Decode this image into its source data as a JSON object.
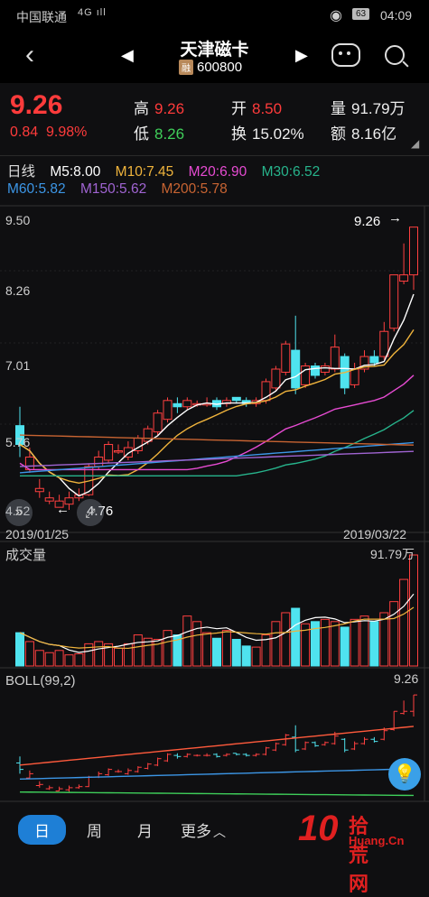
{
  "status": {
    "carrier": "中国联通",
    "signal": "4G ıll",
    "battery": "63",
    "time": "04:09"
  },
  "header": {
    "title": "天津磁卡",
    "badge": "融",
    "code": "600800"
  },
  "quote": {
    "price": "9.26",
    "change": "0.84",
    "change_pct": "9.98%",
    "high_label": "高",
    "high": "9.26",
    "low_label": "低",
    "low": "8.26",
    "open_label": "开",
    "open": "8.50",
    "turnover_label": "换",
    "turnover": "15.02%",
    "volume_label": "量",
    "volume": "91.79万",
    "amount_label": "额",
    "amount": "8.16亿"
  },
  "ma": {
    "period": "日线",
    "m5": "M5:8.00",
    "m10": "M10:7.45",
    "m20": "M20:6.90",
    "m30": "M30:6.52",
    "m60": "M60:5.82",
    "m150": "M150:5.62",
    "m200": "M200:5.78",
    "colors": {
      "m5": "#ffffff",
      "m10": "#f0b43c",
      "m20": "#e64bd2",
      "m30": "#27b48c",
      "m60": "#3c96e6",
      "m150": "#a064d2",
      "m200": "#c86432"
    }
  },
  "kline": {
    "y_top": "9.50",
    "y_mid1": "8.26",
    "y_mid2": "7.01",
    "y_low": "5.76",
    "y_min": "4.52",
    "marker_high": "9.26",
    "marker_low": "4.76",
    "date_start": "2019/01/25",
    "date_end": "2019/03/22",
    "candles": [
      [
        6.1,
        5.8,
        5.6,
        6.4
      ],
      [
        5.4,
        5.6,
        5.35,
        5.75
      ],
      [
        5.05,
        5.1,
        4.95,
        5.25
      ],
      [
        4.9,
        4.95,
        4.85,
        5.05
      ],
      [
        4.8,
        4.9,
        4.8,
        5.0
      ],
      [
        4.85,
        4.95,
        4.76,
        5.05
      ],
      [
        4.95,
        5.0,
        4.9,
        5.1
      ],
      [
        5.0,
        5.45,
        4.98,
        5.5
      ],
      [
        5.45,
        5.6,
        5.4,
        5.7
      ],
      [
        5.55,
        5.8,
        5.5,
        5.85
      ],
      [
        5.7,
        5.7,
        5.65,
        5.8
      ],
      [
        5.6,
        5.75,
        5.55,
        5.85
      ],
      [
        5.7,
        5.9,
        5.65,
        5.95
      ],
      [
        5.85,
        6.05,
        5.8,
        6.1
      ],
      [
        6.0,
        6.3,
        5.95,
        6.35
      ],
      [
        6.2,
        6.5,
        6.15,
        6.55
      ],
      [
        6.45,
        6.4,
        6.3,
        6.55
      ],
      [
        6.4,
        6.5,
        6.35,
        6.55
      ],
      [
        6.45,
        6.45,
        6.4,
        6.5
      ],
      [
        6.45,
        6.45,
        6.4,
        6.55
      ],
      [
        6.5,
        6.4,
        6.35,
        6.55
      ],
      [
        6.45,
        6.5,
        6.4,
        6.55
      ],
      [
        6.55,
        6.5,
        6.45,
        6.55
      ],
      [
        6.5,
        6.45,
        6.4,
        6.55
      ],
      [
        6.45,
        6.5,
        6.4,
        6.55
      ],
      [
        6.5,
        6.8,
        6.45,
        6.85
      ],
      [
        6.7,
        7.0,
        6.65,
        7.05
      ],
      [
        6.95,
        7.4,
        6.9,
        7.45
      ],
      [
        7.3,
        6.7,
        6.6,
        7.85
      ],
      [
        6.75,
        7.05,
        6.7,
        7.1
      ],
      [
        7.05,
        6.9,
        6.85,
        7.1
      ],
      [
        6.95,
        7.05,
        6.9,
        7.1
      ],
      [
        7.0,
        7.35,
        6.95,
        7.55
      ],
      [
        7.2,
        6.7,
        6.6,
        7.25
      ],
      [
        6.75,
        7.0,
        6.7,
        7.1
      ],
      [
        7.0,
        7.2,
        6.95,
        7.3
      ],
      [
        7.2,
        7.1,
        7.05,
        7.3
      ],
      [
        7.2,
        7.6,
        7.15,
        7.75
      ],
      [
        7.65,
        8.5,
        7.6,
        8.5
      ],
      [
        8.4,
        8.5,
        8.35,
        9.0
      ],
      [
        8.5,
        9.26,
        8.26,
        9.26
      ]
    ],
    "volumes": [
      0.3,
      0.22,
      0.14,
      0.12,
      0.14,
      0.1,
      0.11,
      0.2,
      0.22,
      0.2,
      0.16,
      0.2,
      0.28,
      0.25,
      0.24,
      0.32,
      0.28,
      0.45,
      0.4,
      0.3,
      0.25,
      0.32,
      0.24,
      0.18,
      0.17,
      0.28,
      0.4,
      0.48,
      0.52,
      0.38,
      0.4,
      0.42,
      0.4,
      0.35,
      0.42,
      0.45,
      0.4,
      0.48,
      0.58,
      0.78,
      1.0
    ]
  },
  "volume_panel": {
    "label": "成交量",
    "max": "91.79万"
  },
  "boll_panel": {
    "label": "BOLL(99,2)",
    "marker": "9.26"
  },
  "tabs": {
    "day": "日",
    "week": "周",
    "month": "月",
    "more": "更多"
  },
  "watermark": {
    "big": "10",
    "cn": "拾荒网",
    "url": "Huang.Cn"
  }
}
